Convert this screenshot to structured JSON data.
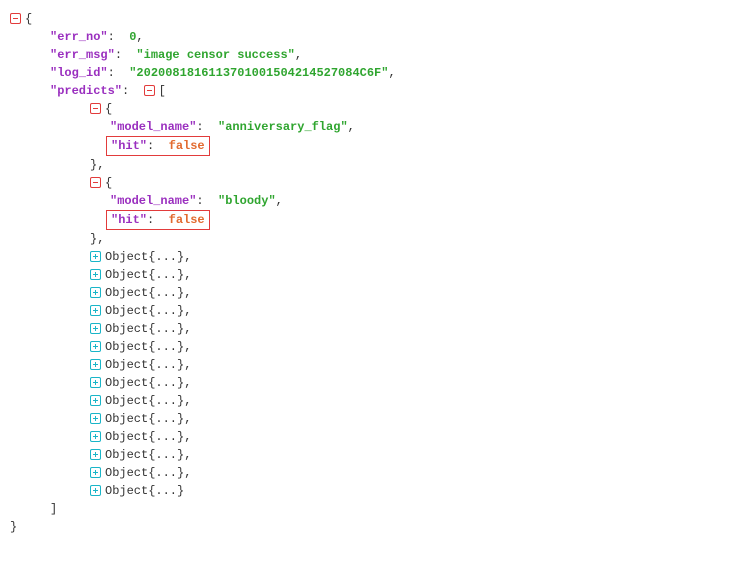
{
  "root": {
    "err_no_key": "\"err_no\"",
    "err_no_val": "0",
    "err_msg_key": "\"err_msg\"",
    "err_msg_val": "\"image censor success\"",
    "log_id_key": "\"log_id\"",
    "log_id_val": "\"2020081816113701001504214527084C6F\"",
    "predicts_key": "\"predicts\""
  },
  "predict0": {
    "model_name_key": "\"model_name\"",
    "model_name_val": "\"anniversary_flag\"",
    "hit_key": "\"hit\"",
    "hit_val": "false"
  },
  "predict1": {
    "model_name_key": "\"model_name\"",
    "model_name_val": "\"bloody\"",
    "hit_key": "\"hit\"",
    "hit_val": "false"
  },
  "collapsed_label": "Object{...}",
  "collapsed_count": 14,
  "punct": {
    "colon": ":",
    "comma": ",",
    "open_brace": "{",
    "close_brace": "}",
    "open_bracket": "[",
    "close_bracket": "]",
    "close_brace_comma": "},"
  }
}
